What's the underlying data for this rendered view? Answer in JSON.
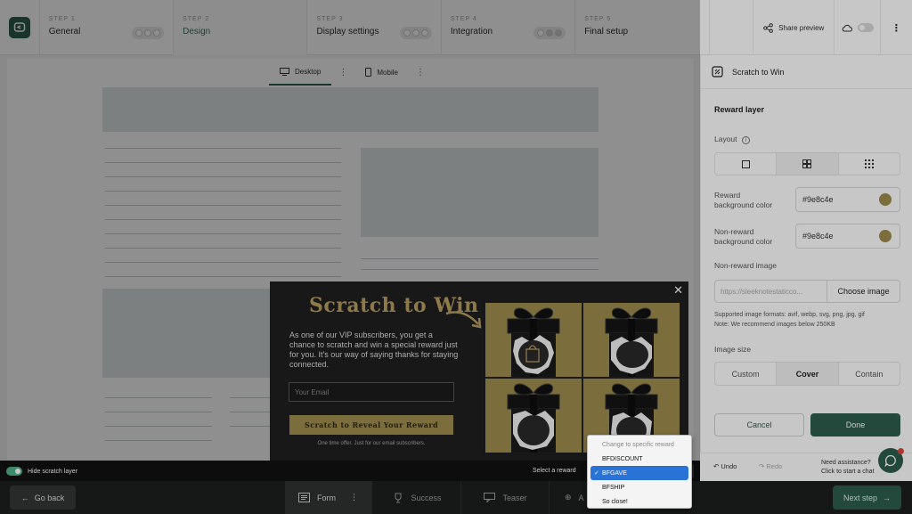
{
  "steps": [
    {
      "num": "STEP 1",
      "name": "General"
    },
    {
      "num": "STEP 2",
      "name": "Design"
    },
    {
      "num": "STEP 3",
      "name": "Display settings"
    },
    {
      "num": "STEP 4",
      "name": "Integration"
    },
    {
      "num": "STEP 5",
      "name": "Final setup"
    }
  ],
  "topbar": {
    "share_label": "Share preview"
  },
  "device_tabs": {
    "desktop": "Desktop",
    "mobile": "Mobile"
  },
  "popup": {
    "title": "Scratch to Win",
    "description": "As one of our VIP subscribers, you get a chance to scratch and win a special reward just for you. It's our way of saying thanks for staying connected.",
    "email_placeholder": "Your Email",
    "cta": "Scratch to Reveal Your Reward",
    "fine_print": "One time offer. Just for our email subscribers.",
    "close": "✕"
  },
  "preview_bar": {
    "hide_label": "Hide scratch layer",
    "select_reward_label": "Select a reward"
  },
  "dropdown": {
    "header": "Change to specific reward",
    "options": [
      "BFDISCOUNT",
      "BFGAVE",
      "BFSHIP",
      "So close!"
    ],
    "selected": "BFGAVE"
  },
  "panel": {
    "title": "Scratch to Win",
    "section": "Reward layer",
    "layout_label": "Layout",
    "reward_bg_label_1": "Reward",
    "reward_bg_label_2": "background color",
    "reward_bg_value": "#9e8c4e",
    "nonreward_bg_label_1": "Non-reward",
    "nonreward_bg_label_2": "background color",
    "nonreward_bg_value": "#9e8c4e",
    "nonreward_image_label": "Non-reward image",
    "image_url": "https://sleeknotestaticco...",
    "choose_image": "Choose image",
    "formats_note": "Supported image formats: avif, webp, svg, png, jpg, gif",
    "size_note": "Note: We recommend images below 250KB",
    "image_size_label": "Image size",
    "image_size_options": [
      "Custom",
      "Cover",
      "Contain"
    ],
    "image_size_selected": "Cover",
    "cancel": "Cancel",
    "done": "Done",
    "undo": "Undo",
    "redo": "Redo",
    "assist_1": "Need assistance?",
    "assist_2": "Click to start a chat"
  },
  "bottom": {
    "go_back": "Go back",
    "tabs": [
      "Form",
      "Success",
      "Teaser",
      "A"
    ],
    "next_step": "Next step"
  },
  "colors": {
    "brand": "#2e5e4e",
    "reward_gold": "#9e8c4e",
    "popup_bg": "#1f1f1f"
  }
}
